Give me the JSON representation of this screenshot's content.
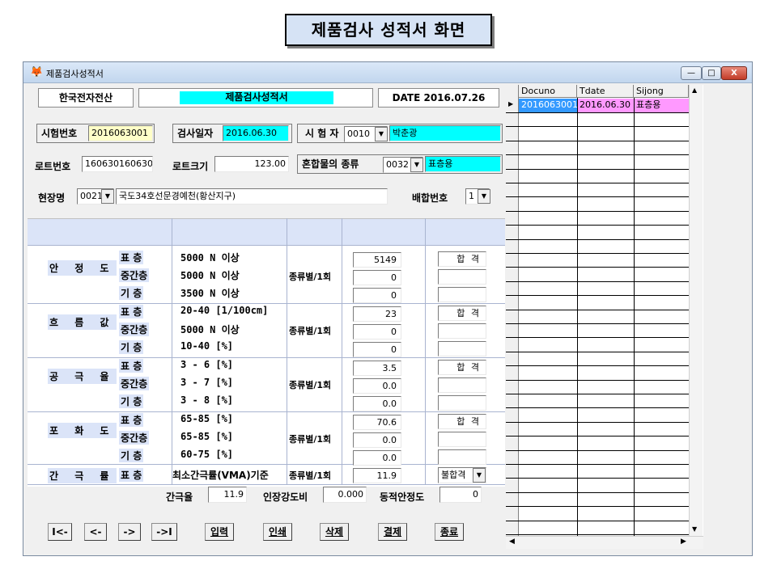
{
  "caption": "제품검사 성적서 화면",
  "window": {
    "title": "제품검사성적서",
    "min": "—",
    "max": "□",
    "close": "X"
  },
  "header": {
    "company": "한국전자전산",
    "form_title": "제품검사성적서",
    "date": "DATE 2016.07.26"
  },
  "form": {
    "test_no_label": "시험번호",
    "test_no": "2016063001",
    "test_date_label": "검사일자",
    "test_date": "2016.06.30",
    "tester_label": "시 험 자",
    "tester_code": "0010",
    "tester_name": "박춘광",
    "lot_no_label": "로트번호",
    "lot_no": "160630160630",
    "lot_size_label": "로트크기",
    "lot_size": "123.00",
    "mix_type_label": "혼합물의 종류",
    "mix_code": "0032",
    "mix_name": "표층용",
    "site_label": "현장명",
    "site_code": "0021",
    "site_name": "국도34호선문경예천(황산지구)",
    "mix_no_label": "배합번호",
    "mix_no": "1"
  },
  "groups": [
    {
      "name": "안 정 도",
      "rows": [
        {
          "layer": "표  층",
          "spec": "5000  N 이상",
          "value": "5149",
          "result": "합 격"
        },
        {
          "layer": "중간층",
          "spec": "5000  N 이상",
          "value": "0",
          "result": ""
        },
        {
          "layer": "기  층",
          "spec": "3500  N 이상",
          "value": "0",
          "result": ""
        }
      ],
      "freq": "종류별/1회"
    },
    {
      "name": "흐 름 값",
      "rows": [
        {
          "layer": "표  층",
          "spec": " 20-40 [1/100cm]",
          "value": "23",
          "result": "합 격"
        },
        {
          "layer": "중간층",
          "spec": " 5000  N 이상",
          "value": "0",
          "result": ""
        },
        {
          "layer": "기  층",
          "spec": " 10-40  [%]",
          "value": "0",
          "result": ""
        }
      ],
      "freq": "종류별/1회"
    },
    {
      "name": "공 극 율",
      "rows": [
        {
          "layer": "표  층",
          "spec": "3 - 6   [%]",
          "value": "3.5",
          "result": "합 격"
        },
        {
          "layer": "중간층",
          "spec": "3 - 7   [%]",
          "value": "0.0",
          "result": ""
        },
        {
          "layer": "기  층",
          "spec": "3 - 8   [%]",
          "value": "0.0",
          "result": ""
        }
      ],
      "freq": "종류별/1회"
    },
    {
      "name": "포 화 도",
      "rows": [
        {
          "layer": "표  층",
          "spec": "65-85   [%]",
          "value": "70.6",
          "result": "합 격"
        },
        {
          "layer": "중간층",
          "spec": "65-85   [%]",
          "value": "0.0",
          "result": ""
        },
        {
          "layer": "기  층",
          "spec": "60-75   [%]",
          "value": "0.0",
          "result": ""
        }
      ],
      "freq": "종류별/1회"
    }
  ],
  "vma": {
    "name": "간 극 률",
    "layer": "표  층",
    "spec": "최소간극률(VMA)기준",
    "freq": "종류별/1회",
    "value": "11.9",
    "result": "불합격"
  },
  "summary": {
    "vma_label": "간극율",
    "vma_value": "11.9",
    "tsr_label": "인장강도비",
    "tsr_value": "0.000",
    "dyn_label": "동적안정도",
    "dyn_value": "0"
  },
  "buttons": {
    "first": "I<-",
    "prev": "<-",
    "next": "->",
    "last": "->I",
    "input": "입력",
    "print": "인쇄",
    "delete": "삭제",
    "approve": "결제",
    "exit": "종료"
  },
  "list": {
    "columns": [
      "Docuno",
      "Tdate",
      "Sijong"
    ],
    "rows": [
      {
        "docuno": "2016063001",
        "tdate": "2016.06.30",
        "sijong": "표층용"
      }
    ]
  }
}
